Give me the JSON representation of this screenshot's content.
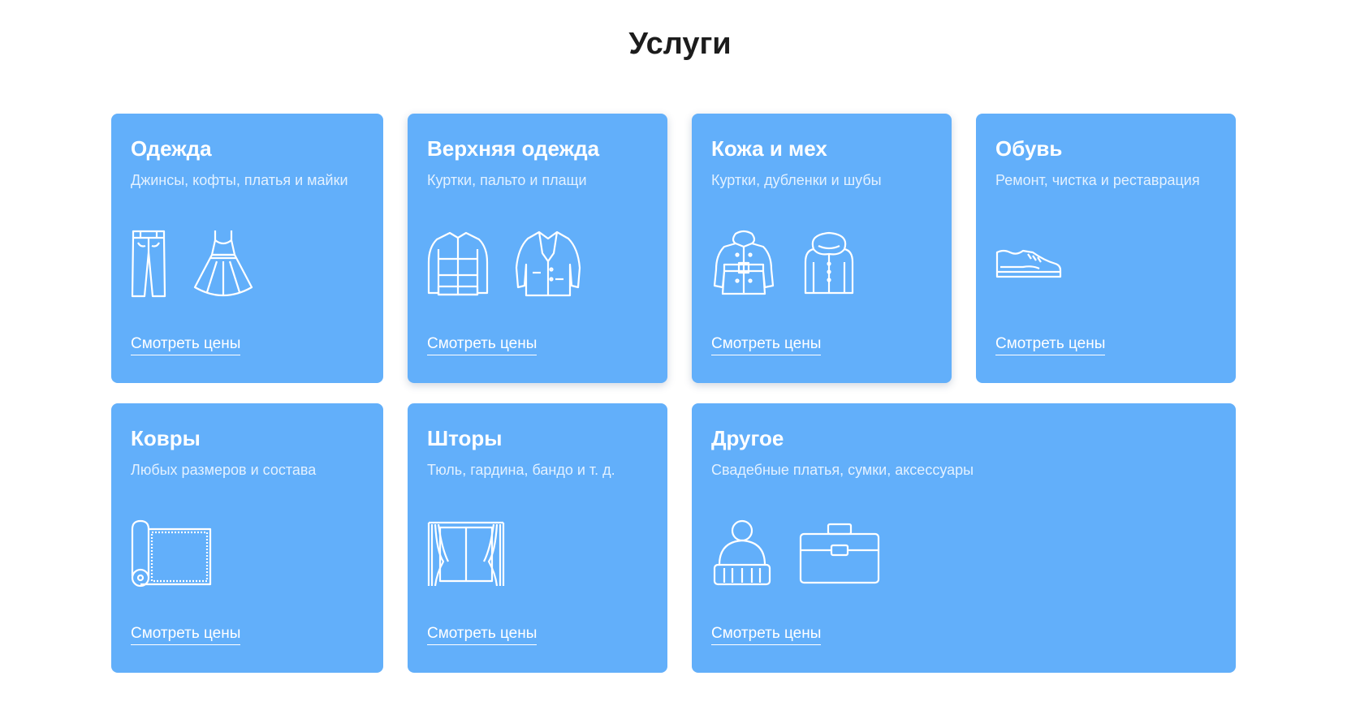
{
  "section": {
    "title": "Услуги"
  },
  "cards": [
    {
      "title": "Одежда",
      "subtitle": "Джинсы, кофты, платья и майки",
      "link": "Смотреть цены",
      "icons": [
        "jeans-icon",
        "dress-icon"
      ]
    },
    {
      "title": "Верхняя одежда",
      "subtitle": "Куртки, пальто и плащи",
      "link": "Смотреть цены",
      "icons": [
        "jacket-icon",
        "coat-icon"
      ]
    },
    {
      "title": "Кожа и мех",
      "subtitle": "Куртки, дубленки и шубы",
      "link": "Смотреть цены",
      "icons": [
        "sheepskin-coat-icon",
        "fur-coat-icon"
      ]
    },
    {
      "title": "Обувь",
      "subtitle": "Ремонт, чистка и реставрация",
      "link": "Смотреть цены",
      "icons": [
        "sneaker-icon"
      ]
    },
    {
      "title": "Ковры",
      "subtitle": "Любых размеров и состава",
      "link": "Смотреть цены",
      "icons": [
        "carpet-roll-icon"
      ]
    },
    {
      "title": "Шторы",
      "subtitle": "Тюль, гардина, бандо и т. д.",
      "link": "Смотреть цены",
      "icons": [
        "curtains-icon"
      ]
    },
    {
      "title": "Другое",
      "subtitle": "Свадебные платья, сумки, аксессуары",
      "link": "Смотреть цены",
      "icons": [
        "winter-hat-icon",
        "briefcase-icon"
      ]
    }
  ],
  "colors": {
    "card_background": "#62affa",
    "title_text": "#1c1c1c",
    "card_text": "#ffffff"
  }
}
